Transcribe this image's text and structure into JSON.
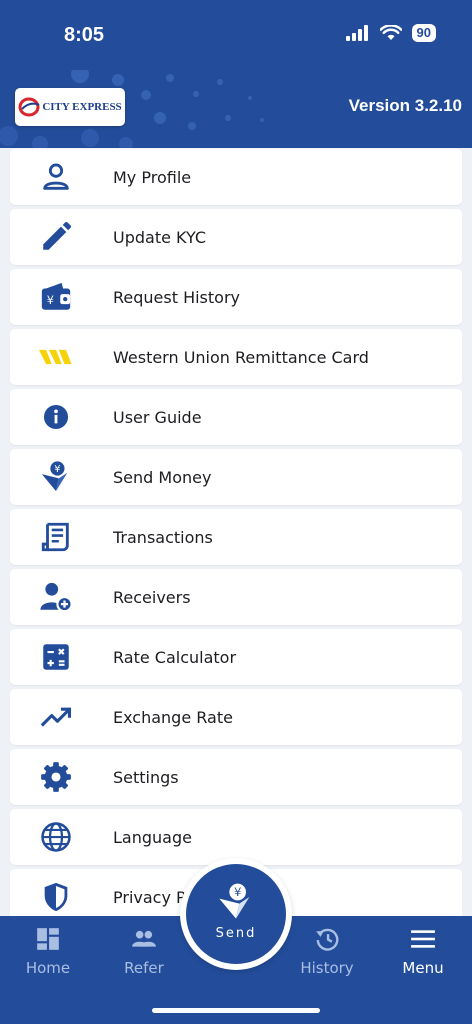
{
  "status_bar": {
    "time": "8:05",
    "battery": "90"
  },
  "header": {
    "brand": "CITY EXPRESS",
    "version": "Version 3.2.10"
  },
  "menu": [
    {
      "id": "my-profile",
      "label": "My Profile",
      "icon": "user-icon"
    },
    {
      "id": "update-kyc",
      "label": "Update KYC",
      "icon": "pencil-icon"
    },
    {
      "id": "request-history",
      "label": "Request History",
      "icon": "wallet-yen-icon"
    },
    {
      "id": "western-union",
      "label": "Western Union Remittance Card",
      "icon": "western-union-icon"
    },
    {
      "id": "user-guide",
      "label": "User Guide",
      "icon": "info-icon"
    },
    {
      "id": "send-money",
      "label": "Send Money",
      "icon": "send-money-icon"
    },
    {
      "id": "transactions",
      "label": "Transactions",
      "icon": "receipt-icon"
    },
    {
      "id": "receivers",
      "label": "Receivers",
      "icon": "add-user-icon"
    },
    {
      "id": "rate-calculator",
      "label": "Rate Calculator",
      "icon": "calculator-icon"
    },
    {
      "id": "exchange-rate",
      "label": "Exchange Rate",
      "icon": "trending-up-icon"
    },
    {
      "id": "settings",
      "label": "Settings",
      "icon": "gear-icon"
    },
    {
      "id": "language",
      "label": "Language",
      "icon": "globe-icon"
    },
    {
      "id": "privacy-policy",
      "label": "Privacy Po",
      "icon": "shield-icon"
    }
  ],
  "bottom_nav": {
    "home": "Home",
    "refer": "Refer",
    "send": "Send",
    "history": "History",
    "menu": "Menu"
  },
  "colors": {
    "primary": "#234d9b",
    "inactive_nav": "#a9bee3",
    "western_union_yellow": "#f5d20a",
    "logo_red": "#d8262c"
  }
}
